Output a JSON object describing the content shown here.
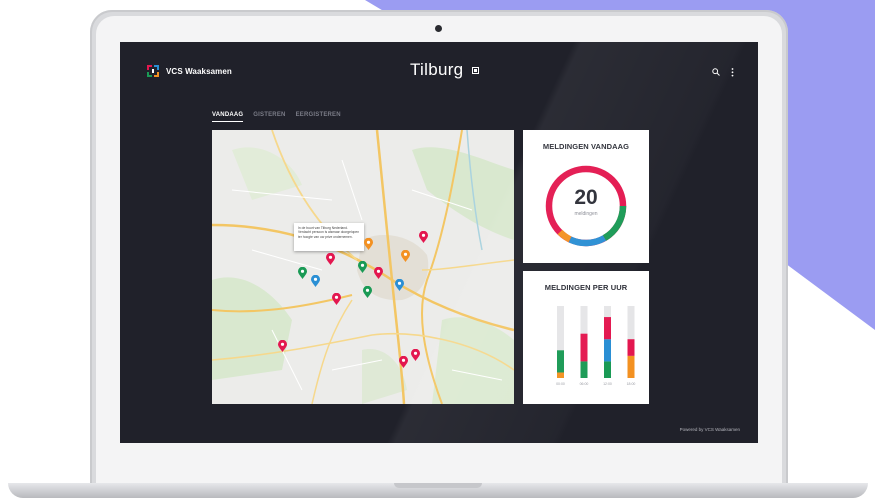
{
  "app": {
    "brand": "VCS Waaksamen",
    "city": "Tilburg",
    "footer": "Powered by VCS Waaksamen"
  },
  "tabs": [
    {
      "label": "VANDAAG",
      "active": true
    },
    {
      "label": "GISTEREN",
      "active": false
    },
    {
      "label": "EERGISTEREN",
      "active": false
    }
  ],
  "map": {
    "tooltip": "In de buurt van Tilburg Nederland. Verdacht persoon is alsmaar doorgelopen ter hoogte van uw prive ondernemen."
  },
  "meldingen_vandaag": {
    "title": "MELDINGEN VANDAAG",
    "count": "20",
    "count_label": "meldingen"
  },
  "meldingen_per_uur": {
    "title": "MELDINGEN PER UUR"
  },
  "chart_data": {
    "type": "bar",
    "title": "MELDINGEN PER UUR",
    "categories": [
      "00:00",
      "06:00",
      "12:00",
      "18:00"
    ],
    "series": [
      {
        "color": "#e3174f",
        "values": [
          0,
          5,
          4,
          3
        ]
      },
      {
        "color": "#2a8fd4",
        "values": [
          0,
          0,
          4,
          0
        ]
      },
      {
        "color": "#1a9a55",
        "values": [
          4,
          3,
          3,
          0
        ]
      },
      {
        "color": "#f39121",
        "values": [
          1,
          0,
          0,
          4
        ]
      }
    ],
    "ylim": [
      0,
      13
    ]
  },
  "colors": {
    "screen_bg": "#20212a",
    "accent_red": "#e3174f",
    "accent_blue": "#2a8fd4",
    "accent_green": "#1a9a55",
    "accent_orange": "#f39121",
    "background_shape": "#9b9cf2"
  }
}
